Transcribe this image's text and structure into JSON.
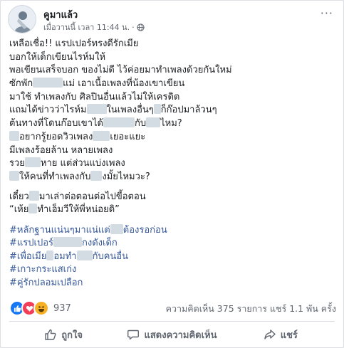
{
  "post": {
    "author": "คูมาแล้ว",
    "time": "เมื่อวานนี้ เวลา 11:44 น.",
    "time_dot": "·",
    "more": "···",
    "lines": [
      "เหลือเชื่อ!! แรปเปอร์ทรงดีรักเมีย",
      "บอกให้เด็กเขียนไรห์มให้",
      "พอเขียนเสร็จบอก ของไม่ดี ไว้ค่อยมาทำเพลงด้วยกันใหม่",
      "ซักพัก",
      "แม่ เอาเนื้อเพลงที่น้องเขาเขียน",
      "มาใช้ ทำเพลงกับ ศิลปินอื่นแล้วไม่ให้เครดิต",
      "แถมได้ข่าวว่าไรห์ม",
      "ในเพลงอื่นๆ",
      "ก็ก๊อปมาล้วนๆ",
      "ต้นทางที่โดนก๊อบเขาได้",
      "กับ",
      "ไหม?",
      "อยากรู้ยอดวิวเพลง",
      "เยอะแยะ",
      "มีเพลงร้อยล้าน หลายเพลง",
      "รวย",
      "หาย แต่ส่วนแบ่งเพลง",
      "ให้คนที่ทำเพลงกับ",
      "งมั้ยไหมวะ?",
      "เดี๋ยว",
      "มาเล่าต่อตอนต่อไปขี้อตอน",
      "“เห้ย",
      "ทำเอ็มวีให้พี่หน่อยดิ”"
    ],
    "hashtags": [
      "#หลักฐานแน่นๆมาแน่แต่",
      "ต้องรอก่อน",
      "#แรปเปอร์",
      "กงดังเด็ก",
      "#เพื่อเมีย",
      "อมทำ",
      "กับคนอื่น",
      "#เกาะกระแสเก่ง",
      "#คู่รักปลอมเปลือก"
    ]
  },
  "stats": {
    "reaction_count": "937",
    "comments_shares": "ความคิดเห็น 375 รายการ  แชร์ 1.1 พัน ครั้ง"
  },
  "actions": {
    "like": "ถูกใจ",
    "comment": "แสดงความคิดเห็น",
    "share": "แชร์"
  },
  "colors": {
    "link": "#365899",
    "like_blue": "#1877f2",
    "love_red": "#f33e58",
    "haha_yellow": "#f7b125"
  }
}
